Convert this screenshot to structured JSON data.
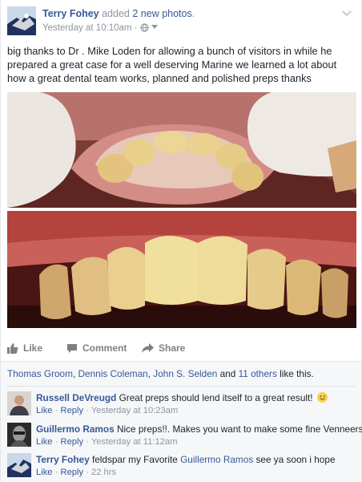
{
  "header": {
    "author": "Terry Fohey",
    "action_pre": "added",
    "action_count": "2 new photos",
    "action_post": ".",
    "timestamp": "Yesterday at 10:10am",
    "meta_sep": "·"
  },
  "post_text": "big thanks to Dr . Mike Loden for allowing a bunch of visitors in while he prepared a great case for a well deserving Marine we learned a lot about how a great dental team works, planned and polished preps thanks",
  "actions": {
    "like": "Like",
    "comment": "Comment",
    "share": "Share"
  },
  "likes": {
    "name1": "Thomas Groom",
    "sep1": ", ",
    "name2": "Dennis Coleman",
    "sep2": ", ",
    "name3": "John S. Selden",
    "and": " and ",
    "others": "11 others",
    "suffix": " like this."
  },
  "comments": [
    {
      "name": "Russell DeVreugd",
      "text": "Great preps should lend itself to a great result!",
      "like": "Like",
      "reply": "Reply",
      "dot": "·",
      "time": "Yesterday at 10:23am"
    },
    {
      "name": "Guillermo Ramos",
      "text": "Nice preps!!. Makes you want to make some fine Venneers",
      "like": "Like",
      "reply": "Reply",
      "dot": "·",
      "time": "Yesterday at 11:12am"
    },
    {
      "name": "Terry Fohey",
      "text_pre": "feldspar my Favorite",
      "mention": "Guillermo Ramos",
      "text_post": "see ya soon i hope",
      "like": "Like",
      "reply": "Reply",
      "dot": "·",
      "time": "22 hrs"
    }
  ],
  "colors": {
    "link": "#365899",
    "meta": "#90949c",
    "text": "#1d2129",
    "social_bg": "#f6f7f9"
  },
  "icons": {
    "privacy": "globe-icon",
    "options": "chevron-down-icon",
    "like": "thumbs-up-icon",
    "comment": "speech-bubble-icon",
    "share": "share-arrow-icon",
    "emoji": "smiley-emoji-icon"
  }
}
